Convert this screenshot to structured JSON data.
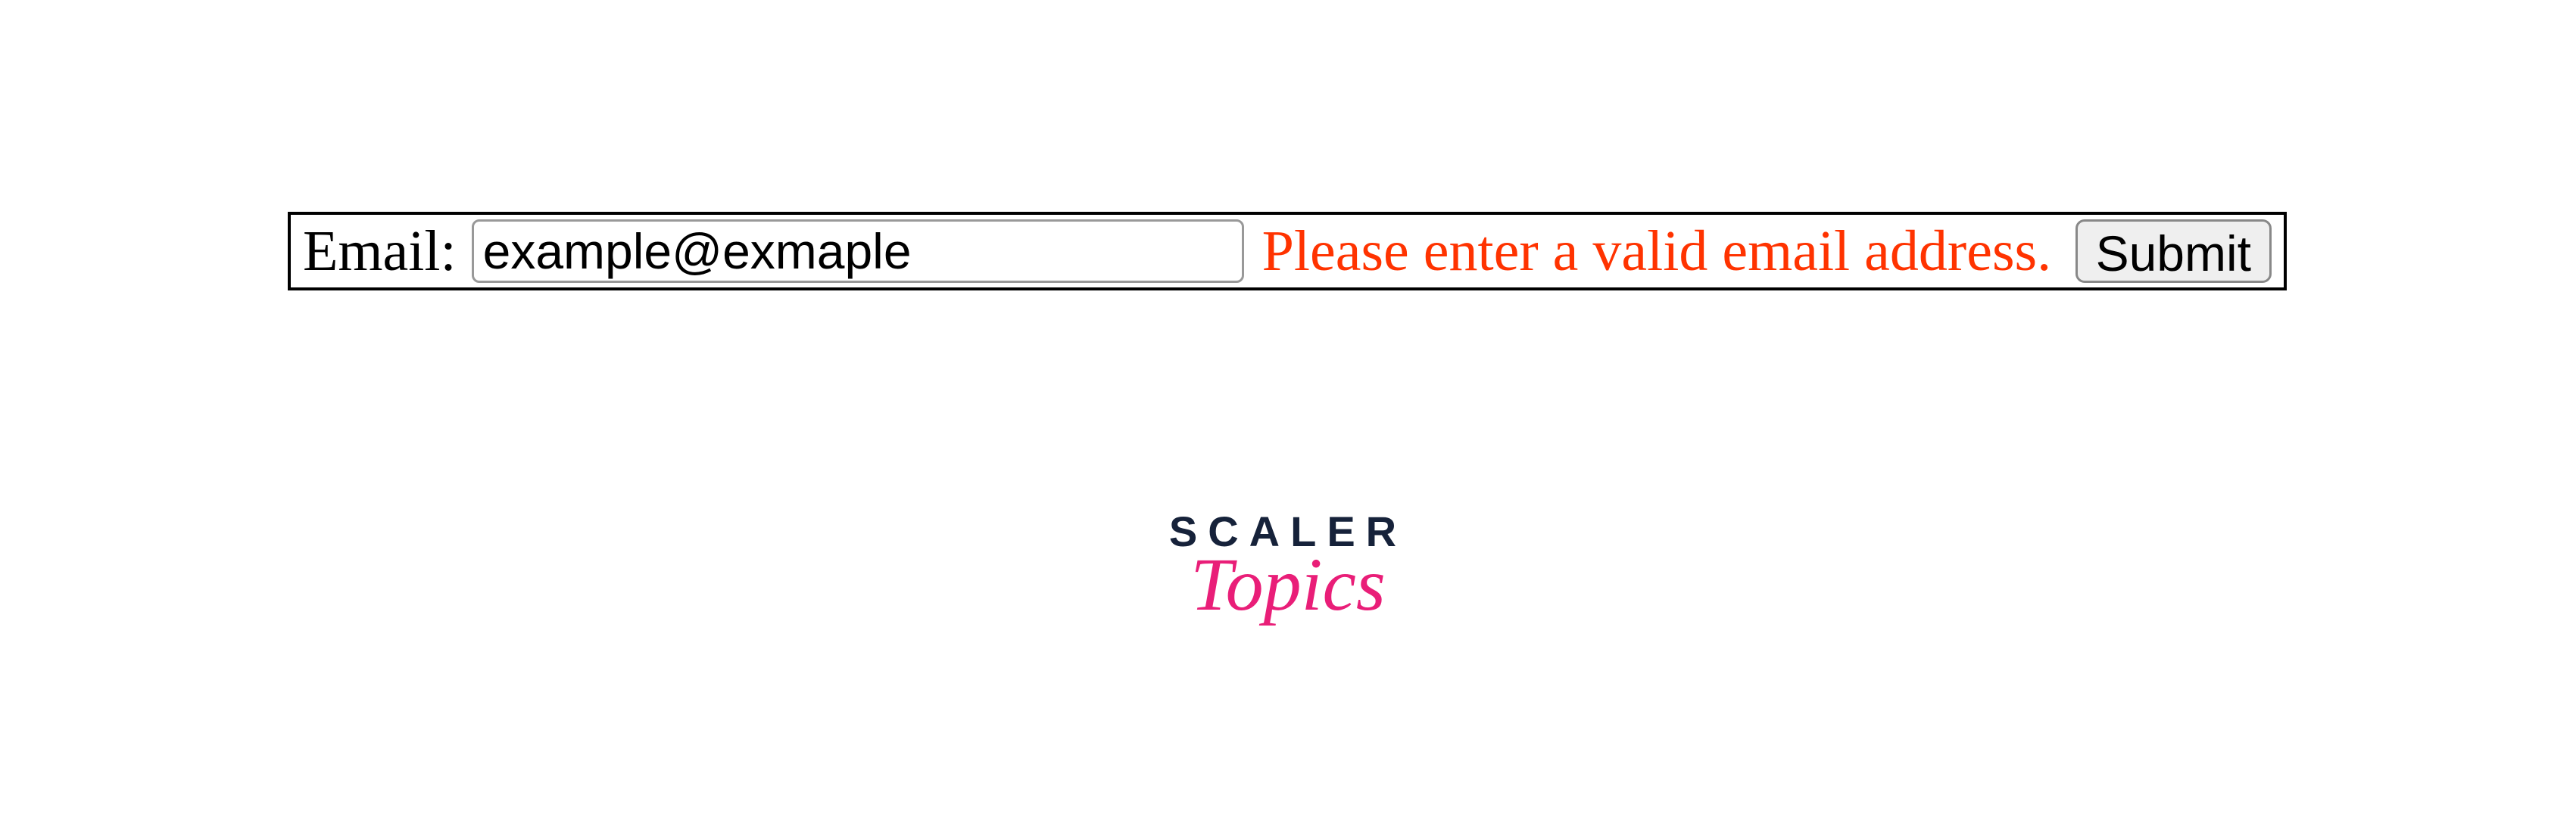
{
  "form": {
    "email_label": "Email:",
    "email_value": "example@exmaple",
    "error_message": "Please enter a valid email address.",
    "submit_label": "Submit"
  },
  "logo": {
    "line1": "SCALER",
    "line2": "Topics"
  },
  "colors": {
    "error": "#ff3300",
    "logo_dark": "#16223a",
    "logo_pink": "#e91e78"
  }
}
